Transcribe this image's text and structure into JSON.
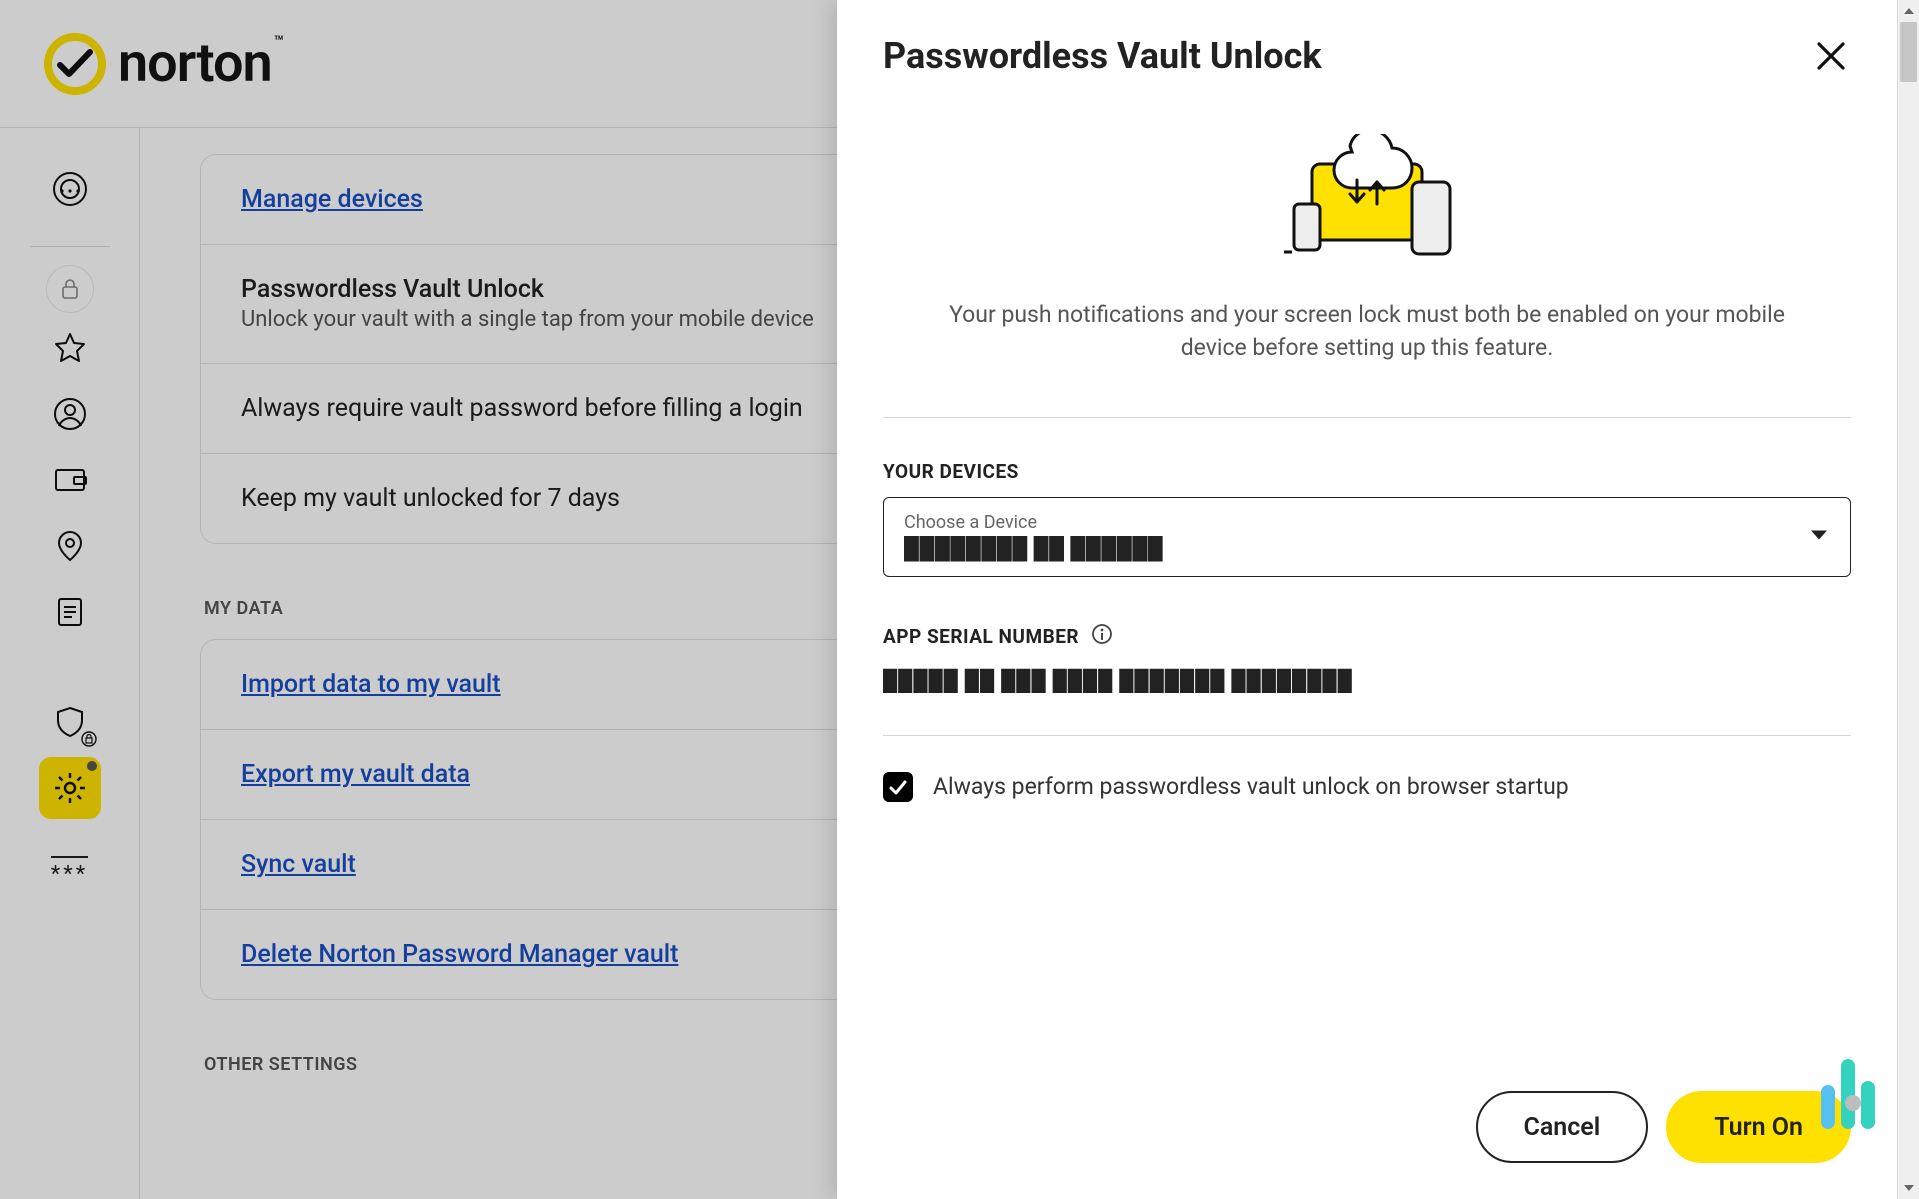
{
  "brand": {
    "name": "norton"
  },
  "background": {
    "rows": {
      "manage_devices": "Manage devices",
      "pvu_title": "Passwordless Vault Unlock",
      "pvu_sub": "Unlock your vault with a single tap from your mobile device",
      "require_pw": "Always require vault password before filling a login",
      "keep_unlocked": "Keep my vault unlocked for 7 days"
    },
    "sections": {
      "my_data": "MY DATA",
      "other_settings": "OTHER SETTINGS"
    },
    "mydata": {
      "import": "Import data to my vault",
      "export": "Export my vault data",
      "sync": "Sync vault",
      "delete": "Delete Norton Password Manager vault"
    }
  },
  "modal": {
    "title": "Passwordless Vault Unlock",
    "hero_text": "Your push notifications and your screen lock must both be enabled on your mobile device before setting up this feature.",
    "devices_label": "YOUR DEVICES",
    "devices_hint": "Choose a Device",
    "devices_value": "████████   ██ ██████",
    "serial_label": "APP SERIAL NUMBER",
    "serial_value": "█████  ██  ███  ████ ███████  ████████",
    "checkbox_label": "Always perform passwordless vault unlock on browser startup",
    "cancel": "Cancel",
    "turn_on": "Turn On"
  }
}
